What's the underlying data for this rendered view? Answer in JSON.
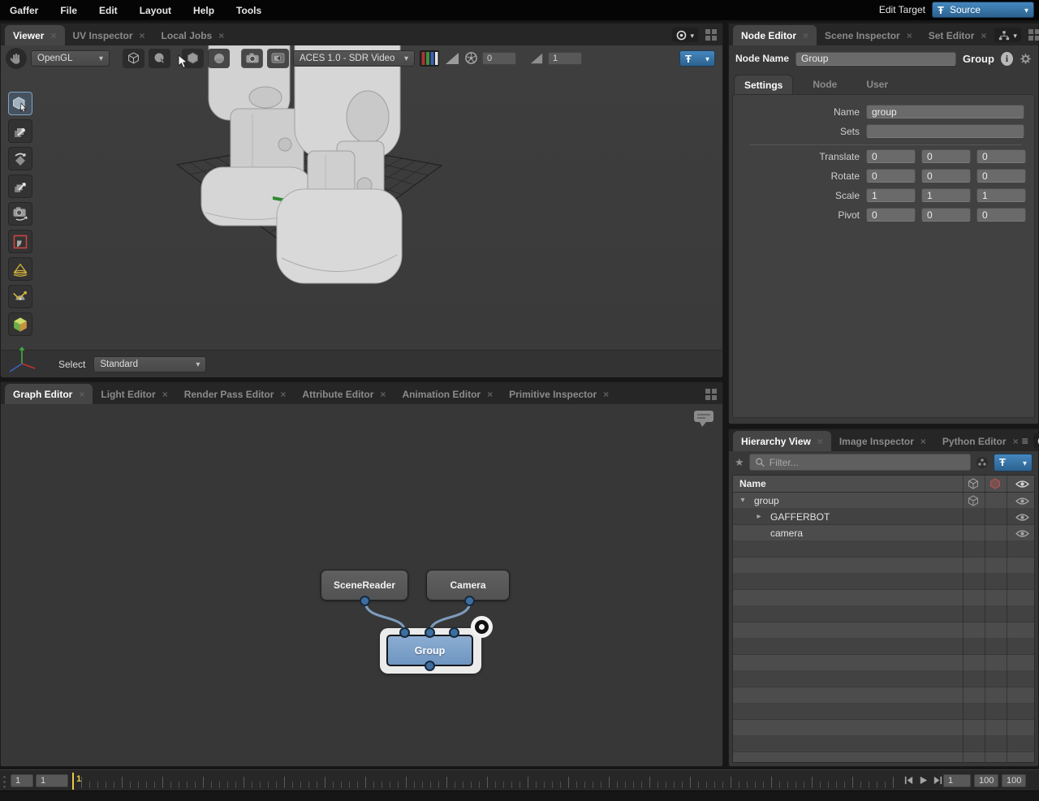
{
  "menubar": {
    "items": [
      "Gaffer",
      "File",
      "Edit",
      "Layout",
      "Help",
      "Tools"
    ],
    "edit_target": {
      "label": "Edit Target",
      "value": "Source"
    }
  },
  "viewer": {
    "tabs": [
      {
        "label": "Viewer",
        "active": true
      },
      {
        "label": "UV Inspector",
        "active": false
      },
      {
        "label": "Local Jobs",
        "active": false
      }
    ],
    "toolbar": {
      "renderer": "OpenGL",
      "display_transform": "ACES 1.0 - SDR Video",
      "exposure": "0",
      "gamma": "1"
    },
    "footer": {
      "select_label": "Select",
      "select_value": "Standard"
    }
  },
  "node_editor": {
    "tabs": [
      {
        "label": "Node Editor",
        "active": true
      },
      {
        "label": "Scene Inspector",
        "active": false
      },
      {
        "label": "Set Editor",
        "active": false
      }
    ],
    "node_name_label": "Node Name",
    "node_name_value": "Group",
    "node_type_label": "Group",
    "subtabs": [
      {
        "label": "Settings",
        "active": true
      },
      {
        "label": "Node",
        "active": false
      },
      {
        "label": "User",
        "active": false
      }
    ],
    "form": {
      "name": {
        "label": "Name",
        "value": "group"
      },
      "sets": {
        "label": "Sets",
        "value": ""
      },
      "translate": {
        "label": "Translate",
        "values": [
          "0",
          "0",
          "0"
        ]
      },
      "rotate": {
        "label": "Rotate",
        "values": [
          "0",
          "0",
          "0"
        ]
      },
      "scale": {
        "label": "Scale",
        "values": [
          "1",
          "1",
          "1"
        ]
      },
      "pivot": {
        "label": "Pivot",
        "values": [
          "0",
          "0",
          "0"
        ]
      }
    }
  },
  "graph_editor": {
    "tabs": [
      {
        "label": "Graph Editor",
        "active": true
      },
      {
        "label": "Light Editor",
        "active": false
      },
      {
        "label": "Render Pass Editor",
        "active": false
      },
      {
        "label": "Attribute Editor",
        "active": false
      },
      {
        "label": "Animation Editor",
        "active": false
      },
      {
        "label": "Primitive Inspector",
        "active": false
      }
    ],
    "nodes": {
      "scene_reader": "SceneReader",
      "camera": "Camera",
      "group": "Group"
    }
  },
  "hierarchy": {
    "tabs": [
      {
        "label": "Hierarchy View",
        "active": true
      },
      {
        "label": "Image Inspector",
        "active": false
      },
      {
        "label": "Python Editor",
        "active": false
      }
    ],
    "filter_placeholder": "Filter...",
    "header": {
      "name": "Name"
    },
    "rows": [
      {
        "name": "group",
        "expander": "open",
        "depth": 0
      },
      {
        "name": "GAFFERBOT",
        "expander": "closed",
        "depth": 1
      },
      {
        "name": "camera",
        "expander": "none",
        "depth": 1
      }
    ]
  },
  "timeline": {
    "left_field_1": "1",
    "left_field_2": "1",
    "playhead_label": "1",
    "right_field_1": "1",
    "right_field_2": "100",
    "right_field_3": "100"
  },
  "colors": {
    "accent_blue": "#3a78ad",
    "node_blue": "#7b9ec9",
    "selection_yellow": "#e9c94c",
    "wire_blue": "#7d9cbe",
    "crop_red": "#cc4444",
    "light_yellow": "#d4b43c"
  },
  "icons": {
    "pin": "Ŧ",
    "dropdown_arrow": "▾",
    "close": "×",
    "star": "★",
    "menu": "≡"
  }
}
